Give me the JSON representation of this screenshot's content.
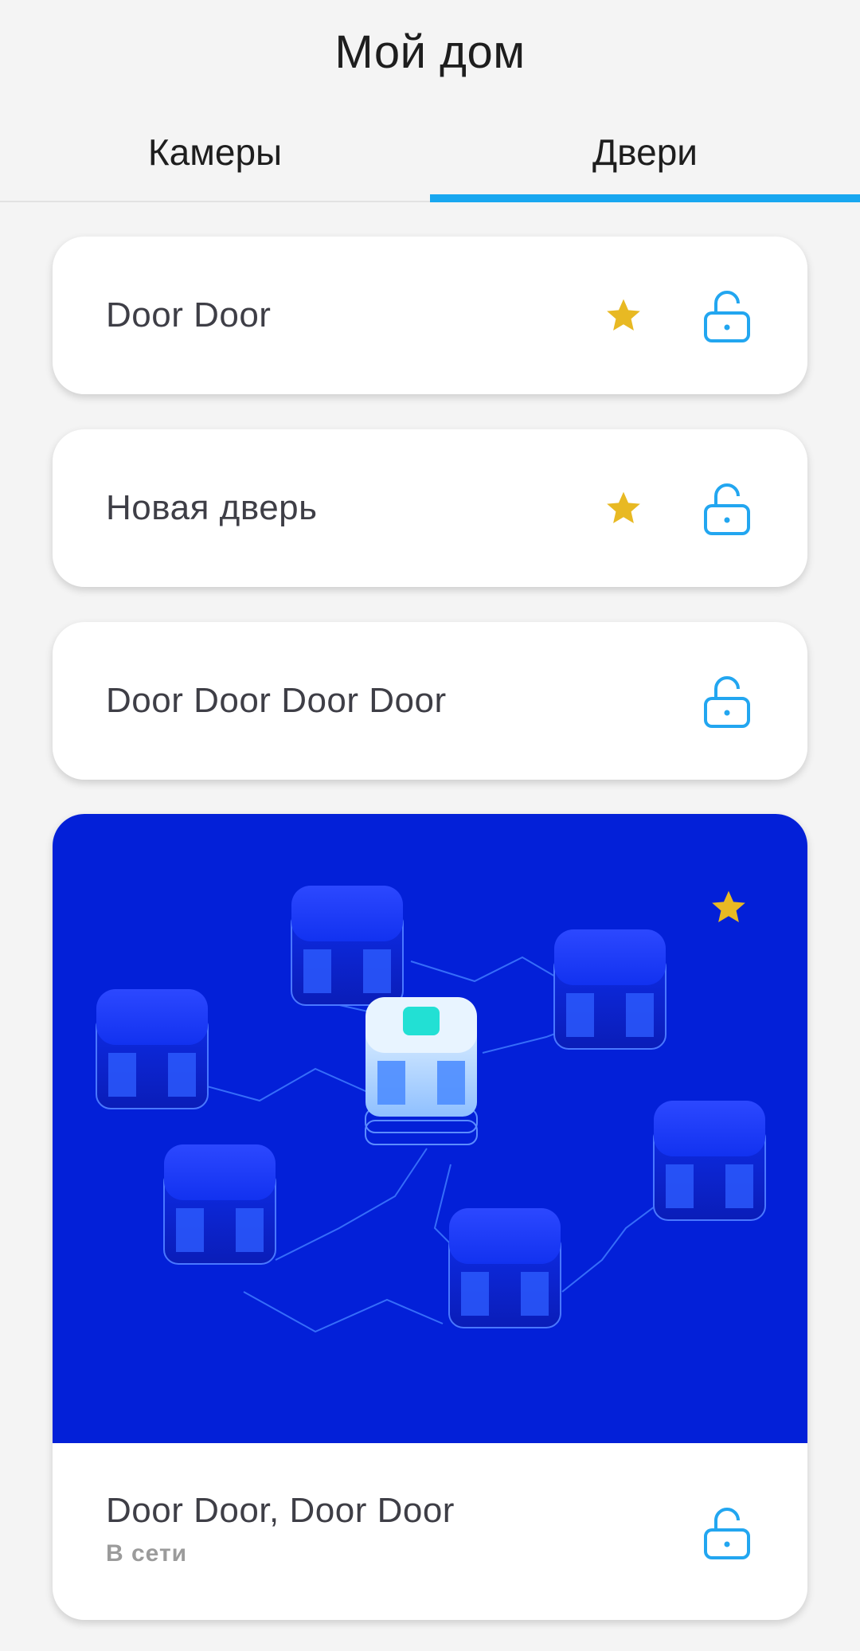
{
  "header": {
    "title": "Мой дом"
  },
  "tabs": [
    {
      "label": "Камеры",
      "active": false
    },
    {
      "label": "Двери",
      "active": true
    }
  ],
  "doors": [
    {
      "name": "Door Door",
      "favorite": true
    },
    {
      "name": "Новая дверь",
      "favorite": true
    },
    {
      "name": "Door Door Door Door",
      "favorite": false
    }
  ],
  "featured_door": {
    "name": "Door Door, Door Door",
    "status": "В сети",
    "favorite": true
  },
  "colors": {
    "accent": "#18a7f0",
    "star": "#e8b923",
    "lock": "#22a6f0",
    "hero_background": "#0320d8"
  },
  "icons": {
    "favorite": "star-icon",
    "lock": "unlocked-padlock-icon"
  }
}
